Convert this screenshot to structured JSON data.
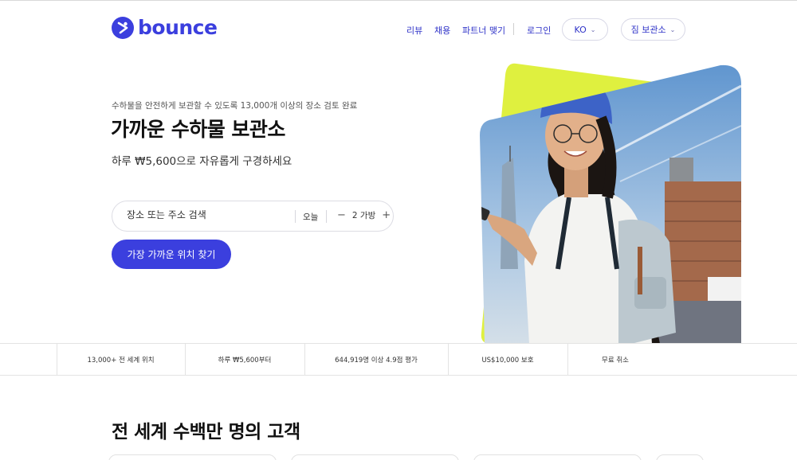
{
  "header": {
    "logo_text": "bounce",
    "nav": [
      "리뷰",
      "채용",
      "파트너 맺기"
    ],
    "login": "로그인",
    "language": "KO",
    "service_menu": "짐 보관소"
  },
  "hero": {
    "eyebrow": "수하물을 안전하게 보관할 수 있도록 13,000개 이상의 장소 검토 완료",
    "title": "가까운 수하물 보관소",
    "subtitle": "하루 ₩5,600으로 자유롭게 구경하세요",
    "search_placeholder": "장소 또는 주소 검색",
    "date": "오늘",
    "bag_count": "2 가방",
    "minus": "−",
    "plus": "+",
    "cta": "가장 가까운 위치 찾기"
  },
  "stats": [
    "13,000+ 전 세계 위치",
    "하루 ₩5,600부터",
    "644,919명 이상 4.9점 평가",
    "US$10,000 보호",
    "무료 취소"
  ],
  "section": {
    "title": "전 세계 수백만 명의 고객"
  },
  "colors": {
    "brand": "#3b3fde",
    "accent_lime": "#dff03f"
  }
}
